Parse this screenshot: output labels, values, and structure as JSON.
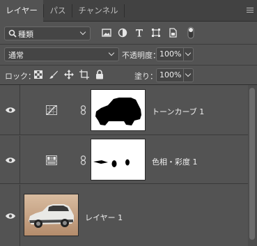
{
  "tabs": [
    {
      "label": "レイヤー",
      "active": true
    },
    {
      "label": "パス",
      "active": false
    },
    {
      "label": "チャンネル",
      "active": false
    }
  ],
  "filter": {
    "kind_label": "種類",
    "icons": [
      "image-filter-icon",
      "adjustment-filter-icon",
      "type-filter-icon",
      "shape-filter-icon",
      "smart-object-filter-icon",
      "filter-toggle-icon"
    ]
  },
  "blend": {
    "mode": "通常",
    "opacity_label": "不透明度：",
    "opacity_value": "100%"
  },
  "lock": {
    "label": "ロック：",
    "fill_label": "塗り：",
    "fill_value": "100%"
  },
  "layers": [
    {
      "name": "トーンカーブ 1",
      "type": "curves-adjustment",
      "visible": true
    },
    {
      "name": "色相・彩度 1",
      "type": "hue-saturation-adjustment",
      "visible": true
    },
    {
      "name": "レイヤー 1",
      "type": "pixel",
      "visible": true
    }
  ],
  "colors": {
    "panel_bg": "#535353",
    "tab_bg": "#424242",
    "field_bg": "#454545"
  }
}
